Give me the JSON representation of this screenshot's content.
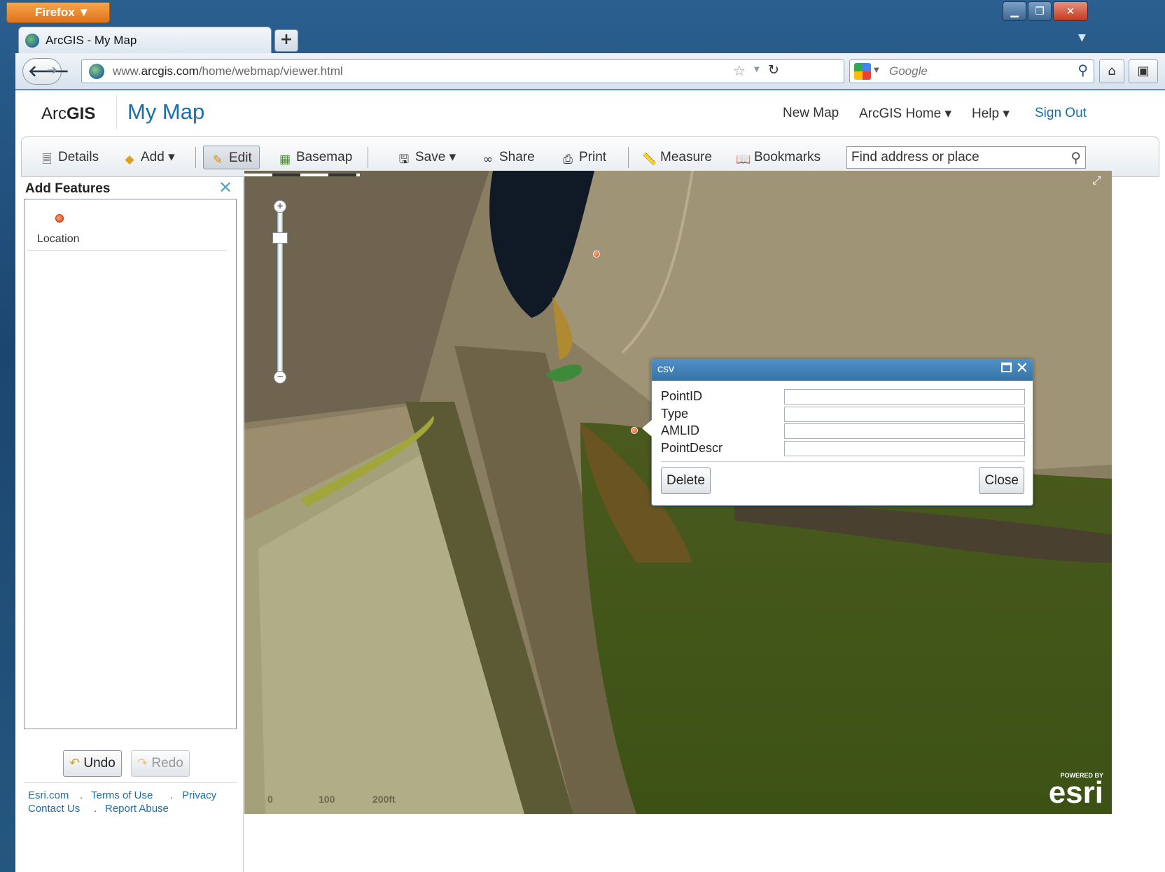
{
  "browser": {
    "menu_label": "Firefox ▼",
    "tab_title": "ArcGIS - My Map",
    "new_tab": "+",
    "url_prefix": "www.",
    "url_domain": "arcgis.com",
    "url_path": "/home/webmap/viewer.html",
    "search_placeholder": "Google",
    "window_controls": [
      "▁",
      "❐",
      "✕"
    ]
  },
  "header": {
    "logo_plain": "Arc",
    "logo_bold": "GIS",
    "map_title": "My Map",
    "links": [
      "New Map",
      "ArcGIS Home ▾",
      "Help ▾",
      "Sign Out"
    ]
  },
  "toolbar": {
    "details": "Details",
    "add": "Add ▾",
    "edit": "Edit",
    "basemap": "Basemap",
    "save": "Save ▾",
    "share": "Share",
    "print": "Print",
    "measure": "Measure",
    "bookmarks": "Bookmarks",
    "find_placeholder": "Find address or place"
  },
  "panel": {
    "title": "Add Features",
    "template_label": "Location",
    "undo": "Undo",
    "redo": "Redo",
    "footer_links": {
      "esri": "Esri.com",
      "terms": "Terms of Use",
      "privacy": "Privacy",
      "contact": "Contact Us",
      "abuse": "Report Abuse",
      "dot": "."
    }
  },
  "map": {
    "scale_labels": [
      "0",
      "100",
      "200ft"
    ],
    "powered_by": "POWERED BY",
    "esri_logo": "esri"
  },
  "popup": {
    "title": "csv",
    "fields": [
      {
        "label": "PointID",
        "value": ""
      },
      {
        "label": "Type",
        "value": ""
      },
      {
        "label": "AMLID",
        "value": ""
      },
      {
        "label": "PointDescr",
        "value": ""
      }
    ],
    "delete": "Delete",
    "close": "Close"
  },
  "colors": {
    "accent": "#1a6ea8",
    "popup_header": "#3f80b8",
    "marker": "#e43e10"
  },
  "icons": [
    "globe-icon",
    "back-icon",
    "forward-icon",
    "star-icon",
    "reload-icon",
    "search-icon",
    "home-icon",
    "details-icon",
    "add-icon",
    "pencil-icon",
    "basemap-icon",
    "save-icon",
    "share-icon",
    "print-icon",
    "measure-icon",
    "bookmarks-icon",
    "close-icon",
    "maximize-icon",
    "undo-icon",
    "redo-icon"
  ]
}
